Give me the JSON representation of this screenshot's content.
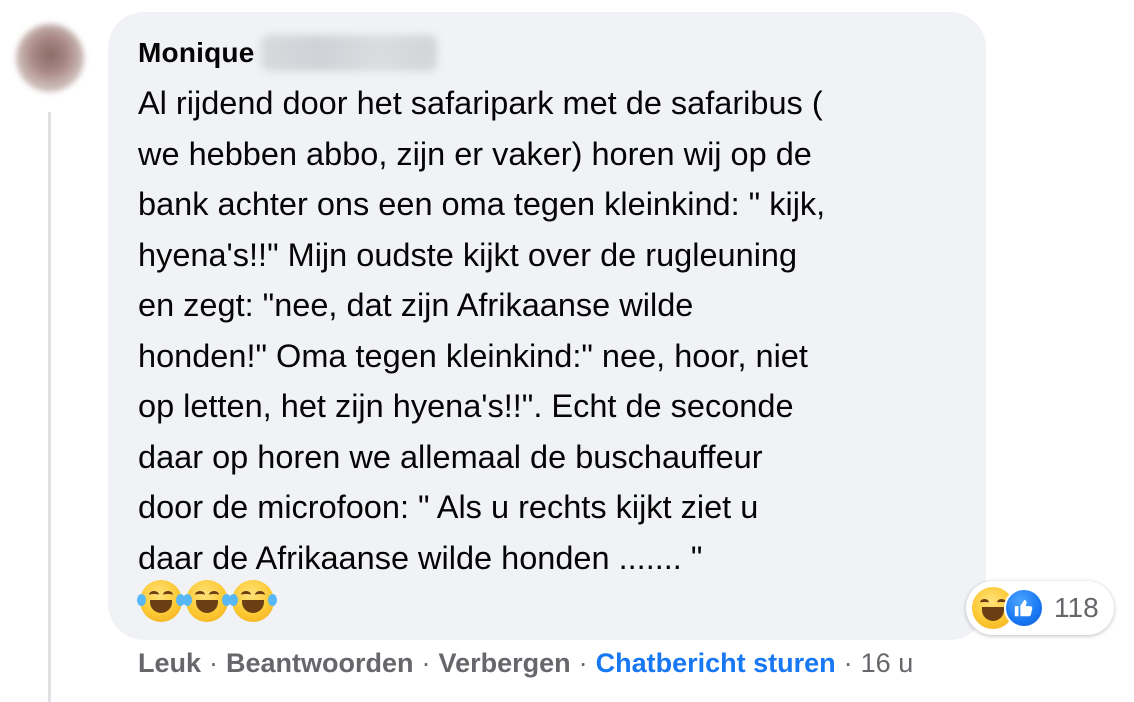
{
  "comment": {
    "author_name": "Monique",
    "text_lines": [
      "Al rijdend door het safaripark met de safaribus (",
      "we hebben abbo, zijn er vaker) horen wij op de",
      "bank achter ons een oma tegen kleinkind: \" kijk,",
      "hyena's!!\" Mijn oudste kijkt over de rugleuning",
      "en zegt: \"nee, dat zijn Afrikaanse wilde",
      "honden!\" Oma tegen kleinkind:\" nee, hoor, niet",
      "op letten, het zijn hyena's!!\". Echt de seconde",
      "daar op horen we allemaal de buschauffeur",
      "door de microfoon: \" Als u rechts kijkt ziet u",
      "daar de Afrikaanse wilde honden ....... \""
    ],
    "emojis": [
      "face-with-tears-of-joy",
      "face-with-tears-of-joy",
      "face-with-tears-of-joy"
    ]
  },
  "reactions": {
    "icons": [
      "haha-reaction-icon",
      "like-reaction-icon"
    ],
    "count": "118",
    "colors": {
      "like": "#1877f2",
      "haha": "#fcc934"
    }
  },
  "actions": {
    "like": "Leuk",
    "reply": "Beantwoorden",
    "hide": "Verbergen",
    "chat": "Chatbericht sturen",
    "separator": "·",
    "timestamp": "16 u"
  },
  "colors": {
    "bubble_bg": "#f0f2f5",
    "text": "#050505",
    "secondary": "#65676b",
    "link_blue": "#1877f2"
  }
}
